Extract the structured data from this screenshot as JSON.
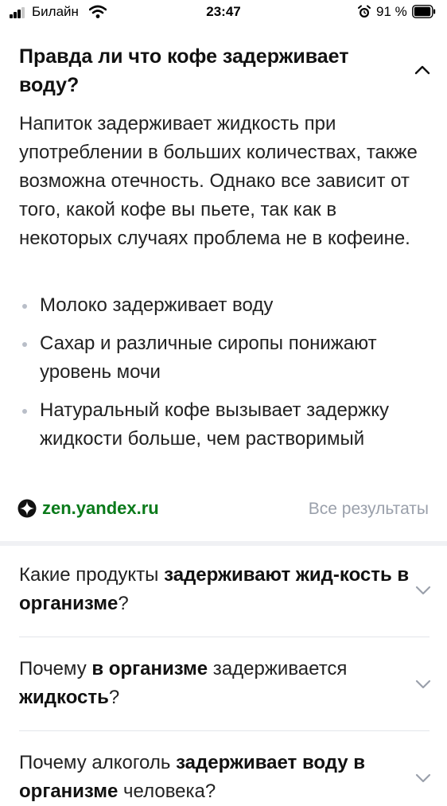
{
  "status_bar": {
    "carrier": "Билайн",
    "time": "23:47",
    "battery_percent": "91 %"
  },
  "answer": {
    "question": "Правда ли что кофе задерживает воду?",
    "text": "Напиток задерживает жидкость при употреблении в больших количествах, также возможна отечность. Однако все зависит от того, какой кофе вы пьете, так как в некоторых случаях проблема не в кофеине.",
    "bullets": [
      "Молоко задерживает воду",
      "Сахар и различные сиропы понижают уровень мочи",
      "Натуральный кофе вызывает задержку жидкости больше, чем растворимый"
    ],
    "source": "zen.yandex.ru",
    "all_results": "Все результаты"
  },
  "related_questions": [
    {
      "parts": [
        "Какие продукты ",
        "задерживают жид-кость в организме",
        "?"
      ]
    },
    {
      "parts": [
        "Почему ",
        "в организме",
        " задерживается ",
        "жидкость",
        "?"
      ]
    },
    {
      "parts": [
        "Почему алкоголь ",
        "задерживает воду в организме",
        " человека?"
      ]
    }
  ],
  "colors": {
    "source_link": "#0a7a1a",
    "muted_text": "#9aa0ab",
    "divider": "#e3e5ea"
  },
  "icons": [
    "signal-icon",
    "wifi-icon",
    "alarm-icon",
    "battery-icon",
    "chevron-up-icon",
    "zen-logo-icon",
    "chevron-down-icon"
  ]
}
